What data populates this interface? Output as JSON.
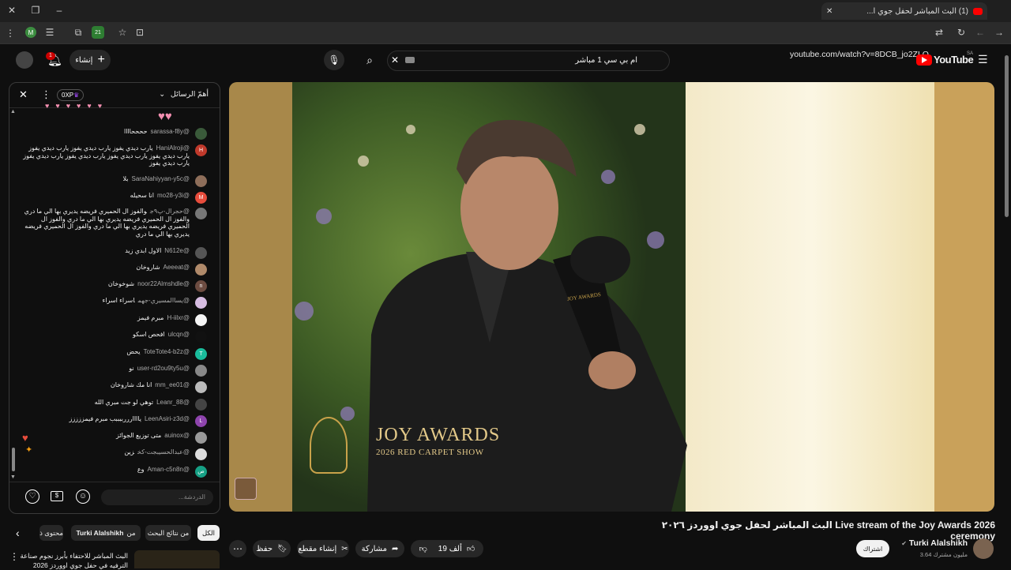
{
  "browser": {
    "tab_title": "(1) البث المباشر لحفل جوي ا...",
    "new_tab": "+",
    "url": "youtube.com/watch?v=8DCB_jo2ZLQ",
    "extension_badge": "21",
    "profile_letter": "M"
  },
  "header": {
    "logo_text": "YouTube",
    "region": "SA",
    "search_value": "ام بي سي 1 مباشر",
    "create_label": "إنشاء",
    "notif_count": "1"
  },
  "chat": {
    "title": "أهمّ الرسائل",
    "xp": "0XP",
    "input_placeholder": "الدردشة...",
    "messages": [
      {
        "author": "@sarassa-f8y",
        "text": "ححححاااا",
        "color": "#3a5a3a"
      },
      {
        "author": "@HaniAlroji",
        "text": "يارب ديدي يفوز يارب ديدي يفوز يارب ديدي يفوز يارب ديدي يفوز يارب ديدي يفوز يارب ديدي يفوز يارب ديدي يفوز يارب ديدي يفوز",
        "color": "#c0392b",
        "letter": "H"
      },
      {
        "author": "@SaraNahiyyan-y5c",
        "text": "بلا",
        "color": "#8e6e5a"
      },
      {
        "author": "@mo28-y3i",
        "text": "انا سحيله",
        "color": "#e74c3c",
        "letter": "M"
      },
      {
        "author": "@حجرال-پ۹ج",
        "text": "والفوز ال الحميري فريضه يديري بها الي ما دري والفوز ال الحميري فريضه يديري بها الي ما دري والفوز ال الحميري فريضه يديري بها الي ما دري والفوز ال الحميري فريضه يديري بها الي ما دري",
        "color": "#777"
      },
      {
        "author": "@N612e",
        "text": "الاول ابدي زيد",
        "color": "#555"
      },
      {
        "author": "@Aeeeat",
        "text": "شاروخان",
        "color": "#b08a6a"
      },
      {
        "author": "@noor22Almshdle",
        "text": "شوخوخان",
        "color": "#6d4c41",
        "letter": "n"
      },
      {
        "author": "@يساالمسيري-جهم",
        "text": "اسراء اسراء",
        "color": "#d7bde2"
      },
      {
        "author": "@H-iilxr",
        "text": "مبرم فيمز",
        "color": "#f5f5f5"
      },
      {
        "author": "@ulcqn",
        "text": "افحص اسكو",
        "color": "#111"
      },
      {
        "author": "@ToteTote4-b2z",
        "text": "يحض",
        "color": "#1abc9c",
        "letter": "T"
      },
      {
        "author": "@user-rd2ou9ty5u",
        "text": "نو",
        "color": "#888"
      },
      {
        "author": "@mm_ee01",
        "text": "انا مك شاروخان",
        "color": "#bbb"
      },
      {
        "author": "@Leanr_88",
        "text": "توهي لو جت مبري الله",
        "color": "#444"
      },
      {
        "author": "@LeenAsiri-z3d",
        "text": "ياااارررببببب مبرم فيمززززز",
        "color": "#8e44ad",
        "letter": "L"
      },
      {
        "author": "@auinox",
        "text": "متى توزيع الجوائز",
        "color": "#999"
      },
      {
        "author": "@عبدالحسيبجت-كخ",
        "text": "زين",
        "color": "#ddd"
      },
      {
        "author": "@Aman-c5n8n",
        "text": "وع",
        "color": "#16a085",
        "letter": "ص"
      }
    ]
  },
  "video": {
    "overlay_title": "JOY AWARDS",
    "overlay_sub": "2026 RED CARPET SHOW",
    "mic_label": "JOY AWARDS"
  },
  "meta": {
    "title": "البث المباشر لحفل جوي اووردز ٢٠٢٦ Live stream of the Joy Awards 2026 ceremony",
    "channel": "Turki Alalshikh",
    "subscribers": "3.64 مليون مشترك",
    "subscribe": "اشتراك",
    "likes": "19 ألف",
    "share": "مشاركة",
    "clip": "إنشاء مقطع",
    "save": "حفظ"
  },
  "chips": {
    "all": "الكل",
    "search_results": "من نتائج البحث",
    "from": "من",
    "channel": "Turki Alalshikh",
    "related": "محتوى ذ"
  },
  "rec": {
    "line1": "البث المباشر للاحتفاء بأبرز نجوم صناعة",
    "line2": "الترفيه في حفل جوي اووردز 2026"
  }
}
